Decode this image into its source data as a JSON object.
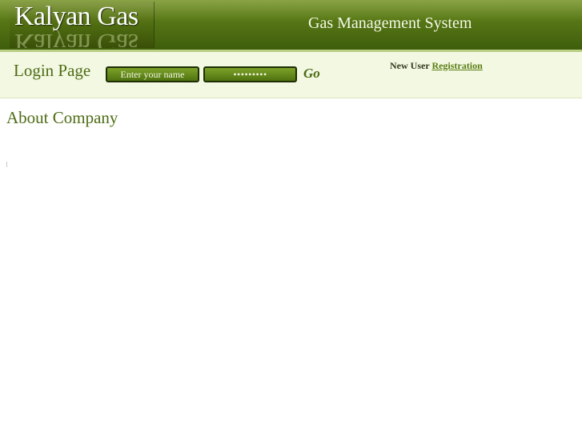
{
  "header": {
    "logo": "Kalyan Gas",
    "system_title": "Gas Management System"
  },
  "login": {
    "title": "Login Page",
    "username_placeholder": "Enter your name",
    "password_value": "•••••••••",
    "go_label": "Go",
    "new_user_label": "New User",
    "registration_link": "Registration"
  },
  "content": {
    "heading": "About Company"
  },
  "colors": {
    "header_green": "#557515",
    "accent_green": "#4e6b15",
    "login_bar_bg": "#f3f8e3",
    "link_green": "#5a7d12"
  }
}
